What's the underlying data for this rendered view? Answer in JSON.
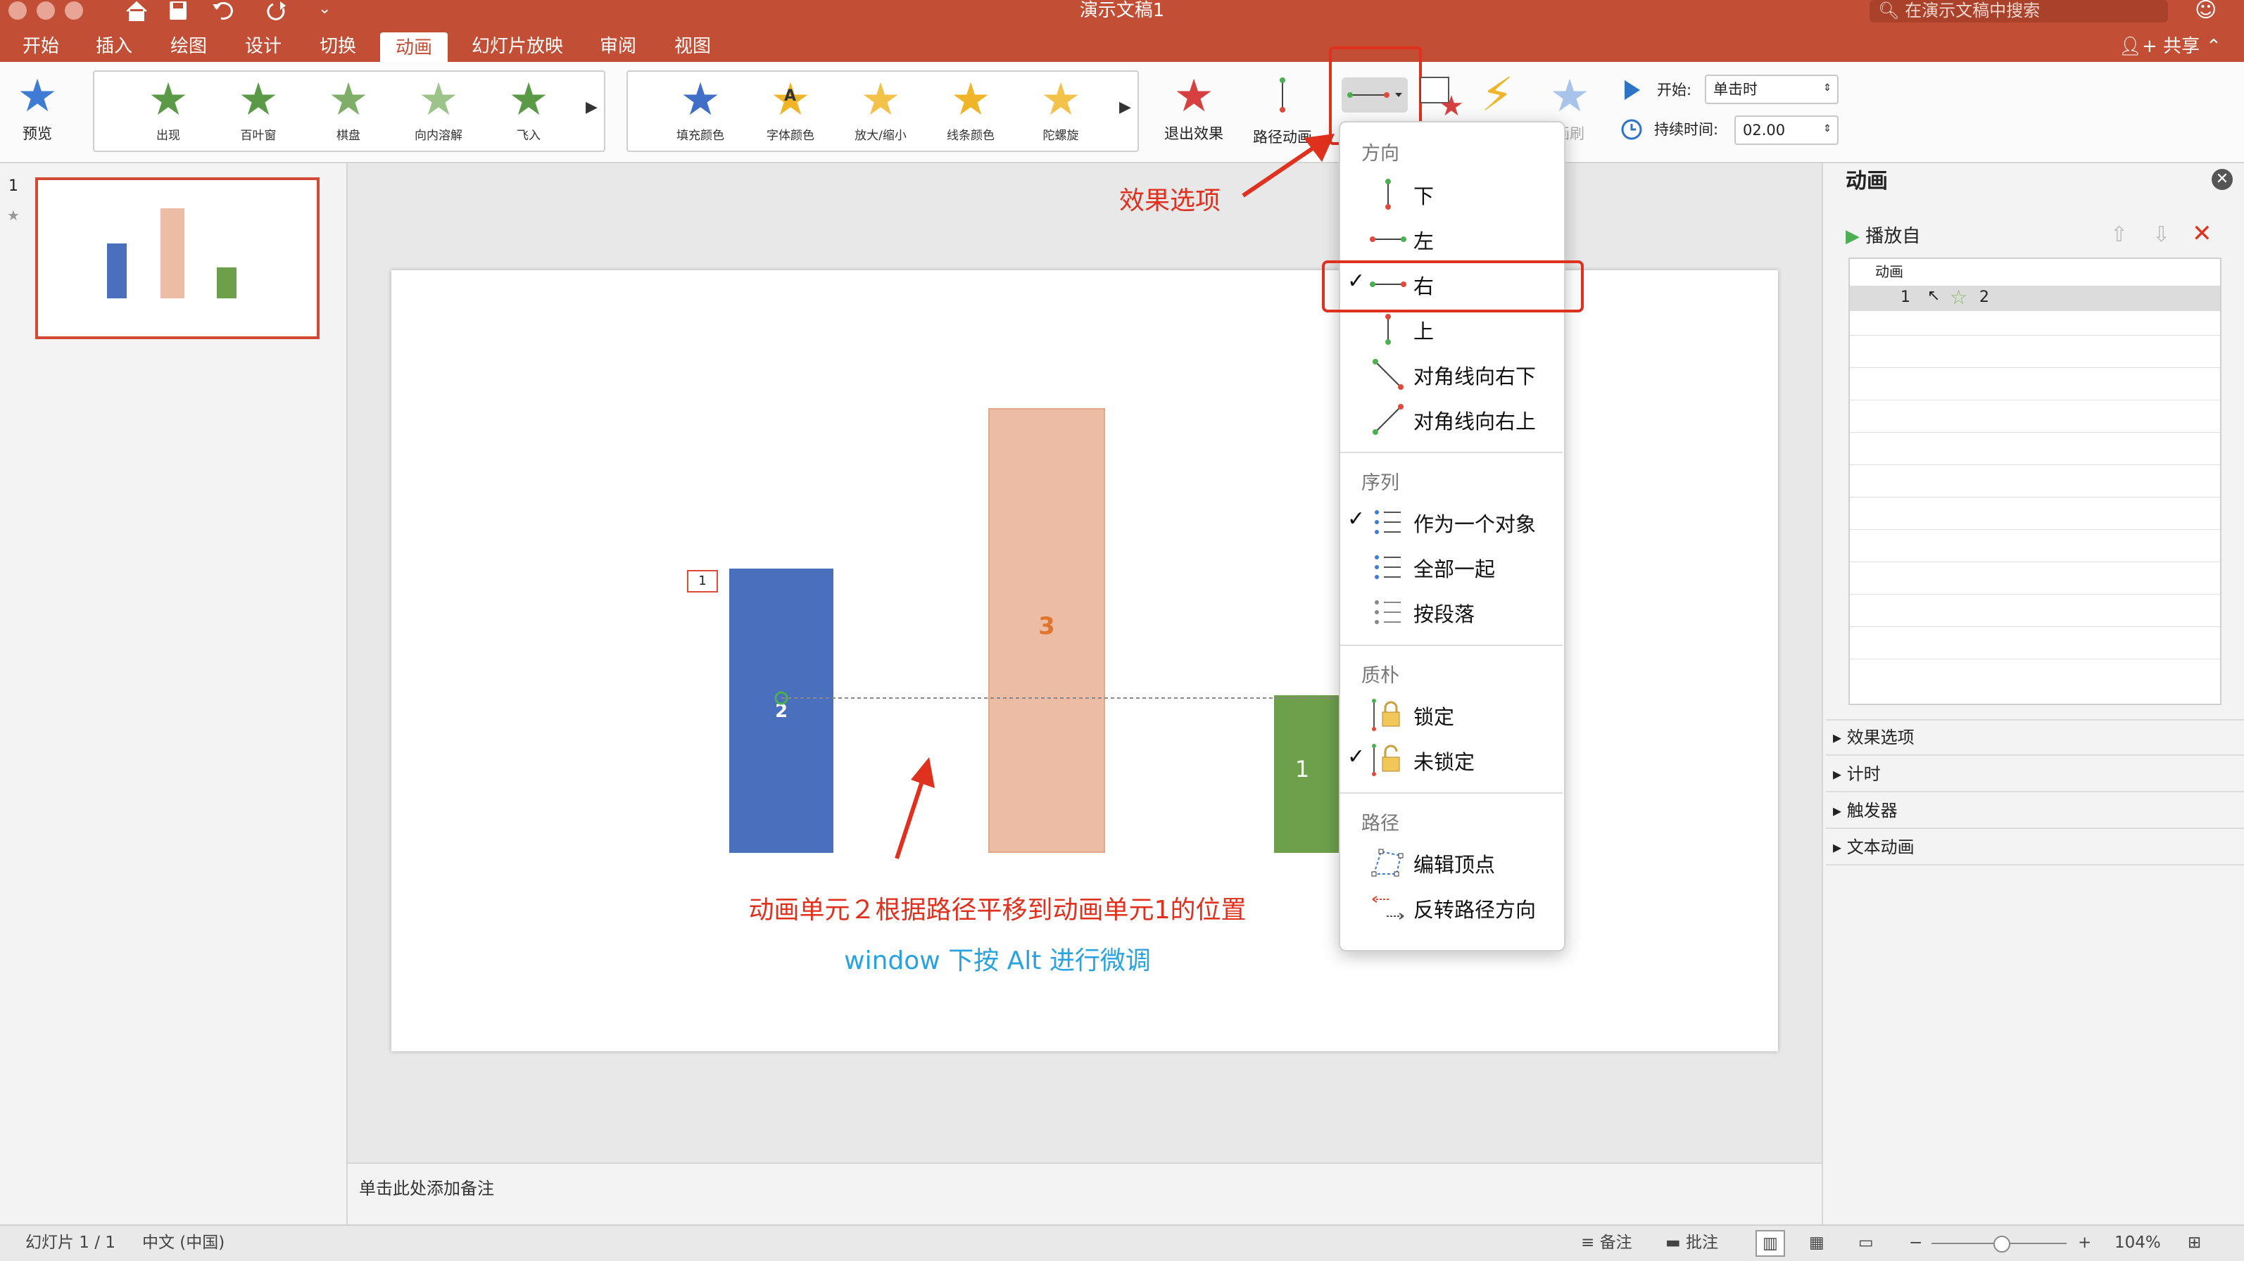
{
  "window": {
    "title": "演示文稿1",
    "search_placeholder": "在演示文稿中搜索",
    "share_label": "共享"
  },
  "tabs": [
    "开始",
    "插入",
    "绘图",
    "设计",
    "切换",
    "动画",
    "幻灯片放映",
    "审阅",
    "视图"
  ],
  "ribbon": {
    "preview_label": "预览",
    "entrance_effects": [
      "出现",
      "百叶窗",
      "棋盘",
      "向内溶解",
      "飞入"
    ],
    "emphasis_effects": [
      "填充颜色",
      "字体颜色",
      "放大/缩小",
      "线条颜色",
      "陀螺旋"
    ],
    "exit_label": "退出效果",
    "path_label": "路径动画",
    "painter_label": "画刷",
    "start_label": "开始:",
    "start_value": "单击时",
    "duration_label": "持续时间:",
    "duration_value": "02.00",
    "font_color_glyph": "A"
  },
  "thumbnail": {
    "slide_number": "1"
  },
  "slide": {
    "bars": [
      {
        "name": "blue-bar",
        "label": "2",
        "color": "#4a6fbd"
      },
      {
        "name": "orange-bar",
        "label": "3",
        "color": "#edbca5"
      },
      {
        "name": "green-bar",
        "label": "1",
        "color": "#6ea04b"
      }
    ],
    "anim_tag": "1",
    "annotation_red": "动画单元２根据路径平移到动画单元1的位置",
    "annotation_blue": "window 下按 Alt 进行微调"
  },
  "callout": {
    "text": "效果选项"
  },
  "effect_menu": {
    "sections": [
      {
        "title": "方向",
        "items": [
          {
            "label": "下",
            "checked": false,
            "icon": "path-down-icon"
          },
          {
            "label": "左",
            "checked": false,
            "icon": "path-left-icon"
          },
          {
            "label": "右",
            "checked": true,
            "icon": "path-right-icon"
          },
          {
            "label": "上",
            "checked": false,
            "icon": "path-up-icon"
          },
          {
            "label": "对角线向右下",
            "checked": false,
            "icon": "path-diag-down-icon"
          },
          {
            "label": "对角线向右上",
            "checked": false,
            "icon": "path-diag-up-icon"
          }
        ]
      },
      {
        "title": "序列",
        "items": [
          {
            "label": "作为一个对象",
            "checked": true,
            "icon": "list-icon"
          },
          {
            "label": "全部一起",
            "checked": false,
            "icon": "list-icon"
          },
          {
            "label": "按段落",
            "checked": false,
            "icon": "list-icon"
          }
        ]
      },
      {
        "title": "质朴",
        "items": [
          {
            "label": "锁定",
            "checked": false,
            "icon": "lock-icon"
          },
          {
            "label": "未锁定",
            "checked": true,
            "icon": "unlock-icon"
          }
        ]
      },
      {
        "title": "路径",
        "items": [
          {
            "label": "编辑顶点",
            "checked": false,
            "icon": "edit-points-icon"
          },
          {
            "label": "反转路径方向",
            "checked": false,
            "icon": "reverse-path-icon"
          }
        ]
      }
    ]
  },
  "anim_pane": {
    "title": "动画",
    "play_from": "播放自",
    "list_header": "动画",
    "entry": {
      "order": "1",
      "name": "2"
    },
    "accordions": [
      "效果选项",
      "计时",
      "触发器",
      "文本动画"
    ]
  },
  "notes_placeholder": "单击此处添加备注",
  "status": {
    "slide_info": "幻灯片 1 / 1",
    "language": "中文 (中国)",
    "notes_label": "备注",
    "comments_label": "批注",
    "zoom_minus": "−",
    "zoom_plus": "+",
    "zoom": "104%"
  },
  "colors": {
    "accent": "#c24f35",
    "highlight": "#e0301e",
    "annotation_blue": "#29a3e0"
  }
}
